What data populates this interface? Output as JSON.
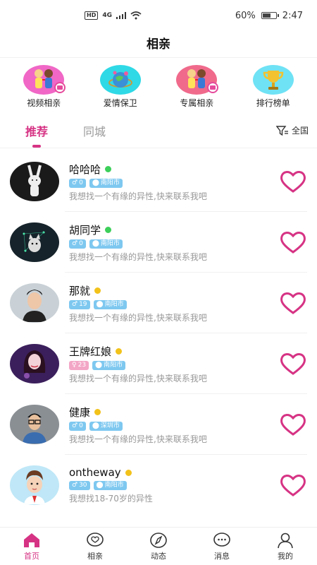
{
  "status": {
    "network": "4G",
    "hd": "HD",
    "battery": "60%",
    "time": "2:47"
  },
  "page_title": "相亲",
  "features": [
    {
      "label": "视频相亲",
      "icon": "couple-video-icon",
      "bg": "#f067c6"
    },
    {
      "label": "爱情保卫",
      "icon": "globe-love-icon",
      "bg": "#2fd9e6"
    },
    {
      "label": "专属相亲",
      "icon": "couple-exclusive-icon",
      "bg": "#f06a8c"
    },
    {
      "label": "排行榜单",
      "icon": "trophy-icon",
      "bg": "#6fe2f5"
    }
  ],
  "tabs": [
    {
      "label": "推荐"
    },
    {
      "label": "同城"
    }
  ],
  "filter_label": "全国",
  "users": [
    {
      "name": "哈哈哈",
      "gender": "♂",
      "age": "0",
      "city": "南阳市",
      "motto": "我想找一个有缘的异性,快来联系我吧",
      "online_color": "#3ccf5a"
    },
    {
      "name": "胡同学",
      "gender": "♂",
      "age": "0",
      "city": "南阳市",
      "motto": "我想找一个有缘的异性,快来联系我吧",
      "online_color": "#3ccf5a"
    },
    {
      "name": "那就",
      "gender": "♂",
      "age": "19",
      "city": "南阳市",
      "motto": "我想找一个有缘的异性,快来联系我吧",
      "online_color": "#f2c21a"
    },
    {
      "name": "王牌红娘",
      "gender": "♀",
      "age": "23",
      "city": "南阳市",
      "motto": "我想找一个有缘的异性,快来联系我吧",
      "online_color": "#f2c21a"
    },
    {
      "name": "健康",
      "gender": "♂",
      "age": "0",
      "city": "深圳市",
      "motto": "我想找一个有缘的异性,快来联系我吧",
      "online_color": "#f2c21a"
    },
    {
      "name": "ontheway",
      "gender": "♂",
      "age": "30",
      "city": "南阳市",
      "motto": "我想找18-70岁的异性",
      "online_color": "#f2c21a"
    }
  ],
  "nav": [
    {
      "label": "首页"
    },
    {
      "label": "相亲"
    },
    {
      "label": "动态"
    },
    {
      "label": "消息"
    },
    {
      "label": "我的"
    }
  ],
  "colors": {
    "accent": "#d63384",
    "heart": "#d63384"
  }
}
